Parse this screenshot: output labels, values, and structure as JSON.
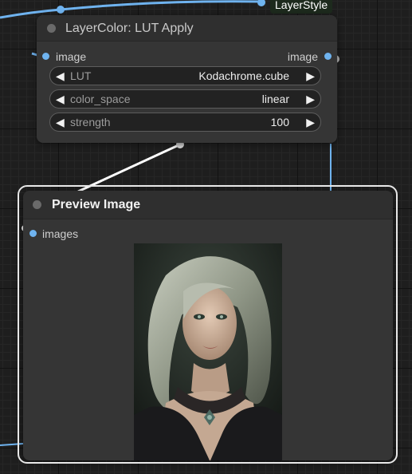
{
  "lut_node": {
    "title": "LayerColor: LUT Apply",
    "input_label": "image",
    "output_label": "image",
    "widgets": [
      {
        "label": "LUT",
        "value": "Kodachrome.cube"
      },
      {
        "label": "color_space",
        "value": "linear"
      },
      {
        "label": "strength",
        "value": "100"
      }
    ]
  },
  "preview_node": {
    "title": "Preview Image",
    "input_label": "images"
  },
  "upstream_badge": "LayerStyle",
  "arrows": {
    "left": "◀",
    "right": "▶"
  },
  "colors": {
    "link_blue": "#6fb3ef",
    "link_white": "#ffffff",
    "node_bg": "#353535",
    "header_bg": "#2f2f2f",
    "canvas_bg": "#1e1e1e"
  }
}
